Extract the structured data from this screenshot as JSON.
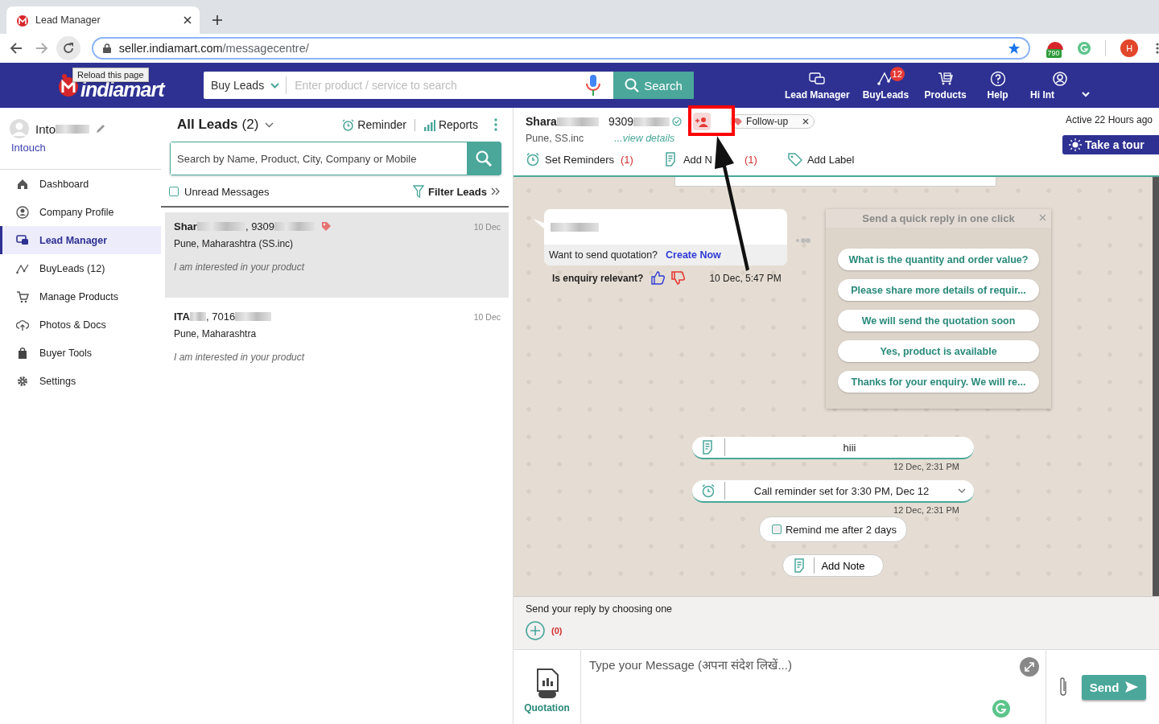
{
  "browser": {
    "tab_title": "Lead Manager",
    "url_host": "seller.indiamart.com",
    "url_path": "/messagecentre/",
    "extension_badge": "790",
    "profile_initial": "H",
    "tooltip": "Reload this page"
  },
  "header": {
    "logo_text": "indiamart",
    "search_category": "Buy Leads",
    "search_placeholder": "Enter product / service to search",
    "search_button": "Search",
    "nav": [
      {
        "label": "Lead Manager",
        "kind": "chat"
      },
      {
        "label": "BuyLeads",
        "kind": "buyleads",
        "badge": "12"
      },
      {
        "label": "Products",
        "kind": "cart"
      },
      {
        "label": "Help",
        "kind": "help"
      },
      {
        "label": "Hi Int",
        "kind": "user"
      }
    ]
  },
  "sidebar": {
    "user_name": "Into",
    "company": "Intouch",
    "items": [
      {
        "label": "Dashboard",
        "selected": false
      },
      {
        "label": "Company Profile",
        "selected": false
      },
      {
        "label": "Lead Manager",
        "selected": true
      },
      {
        "label": "BuyLeads (12)",
        "selected": false
      },
      {
        "label": "Manage Products",
        "selected": false
      },
      {
        "label": "Photos & Docs",
        "selected": false
      },
      {
        "label": "Buyer Tools",
        "selected": false
      },
      {
        "label": "Settings",
        "selected": false
      }
    ]
  },
  "leads": {
    "title": "All Leads",
    "count": "(2)",
    "reminder": "Reminder",
    "reports": "Reports",
    "search_placeholder": "Search by Name, Product, City, Company or Mobile",
    "unread_label": "Unread Messages",
    "unread_checked": false,
    "filter": "Filter Leads",
    "items": [
      {
        "name": "Shar",
        "number": ", 9309",
        "location": "Pune, Maharashtra (SS.inc)",
        "message": "I am interested in your product",
        "date": "10 Dec",
        "tagged": true,
        "selected": true
      },
      {
        "name": "ITA",
        "number": ", 7016",
        "location": "Pune, Maharashtra",
        "message": "I am interested in your product",
        "date": "10 Dec",
        "tagged": false,
        "selected": false
      }
    ]
  },
  "chat": {
    "contact_name": "Shara",
    "contact_phone": "9309",
    "location": "Pune, SS.inc",
    "view_details": "...view details",
    "label_tag": "Follow-up",
    "last_active": "Active 22 Hours ago",
    "tour_button": "Take a tour",
    "actions": [
      {
        "label": "Set Reminders",
        "count": "(1)"
      },
      {
        "label": "Add N",
        "count": "(1)"
      },
      {
        "label": "Add Label"
      }
    ],
    "enquiry": {
      "quotation_prompt": "Want to send quotation?",
      "create_link": "Create Now",
      "relevance_question": "Is enquiry relevant?",
      "time": "10 Dec, 5:47 PM"
    },
    "quick_reply": {
      "title": "Send a quick reply in one click",
      "options": [
        "What is the quantity and order value?",
        "Please share more details of requir...",
        "We will send the quotation soon",
        "Yes, product is available",
        "Thanks for your enquiry. We will re..."
      ]
    },
    "events": [
      {
        "kind": "note",
        "text": "hiii",
        "time": "12 Dec, 2:31 PM"
      },
      {
        "kind": "reminder",
        "text": "Call reminder set for 3:30 PM, Dec 12",
        "time": "12 Dec, 2:31 PM"
      },
      {
        "kind": "checkbox",
        "text": "Remind me after 2 days",
        "checked": false
      },
      {
        "kind": "button",
        "text": "Add Note"
      }
    ]
  },
  "composer": {
    "prompt": "Send your reply by choosing one",
    "template_count": "(0)",
    "placeholder": "Type your Message (अपना संदेश लिखें...)",
    "quotation": "Quotation",
    "send": "Send"
  }
}
